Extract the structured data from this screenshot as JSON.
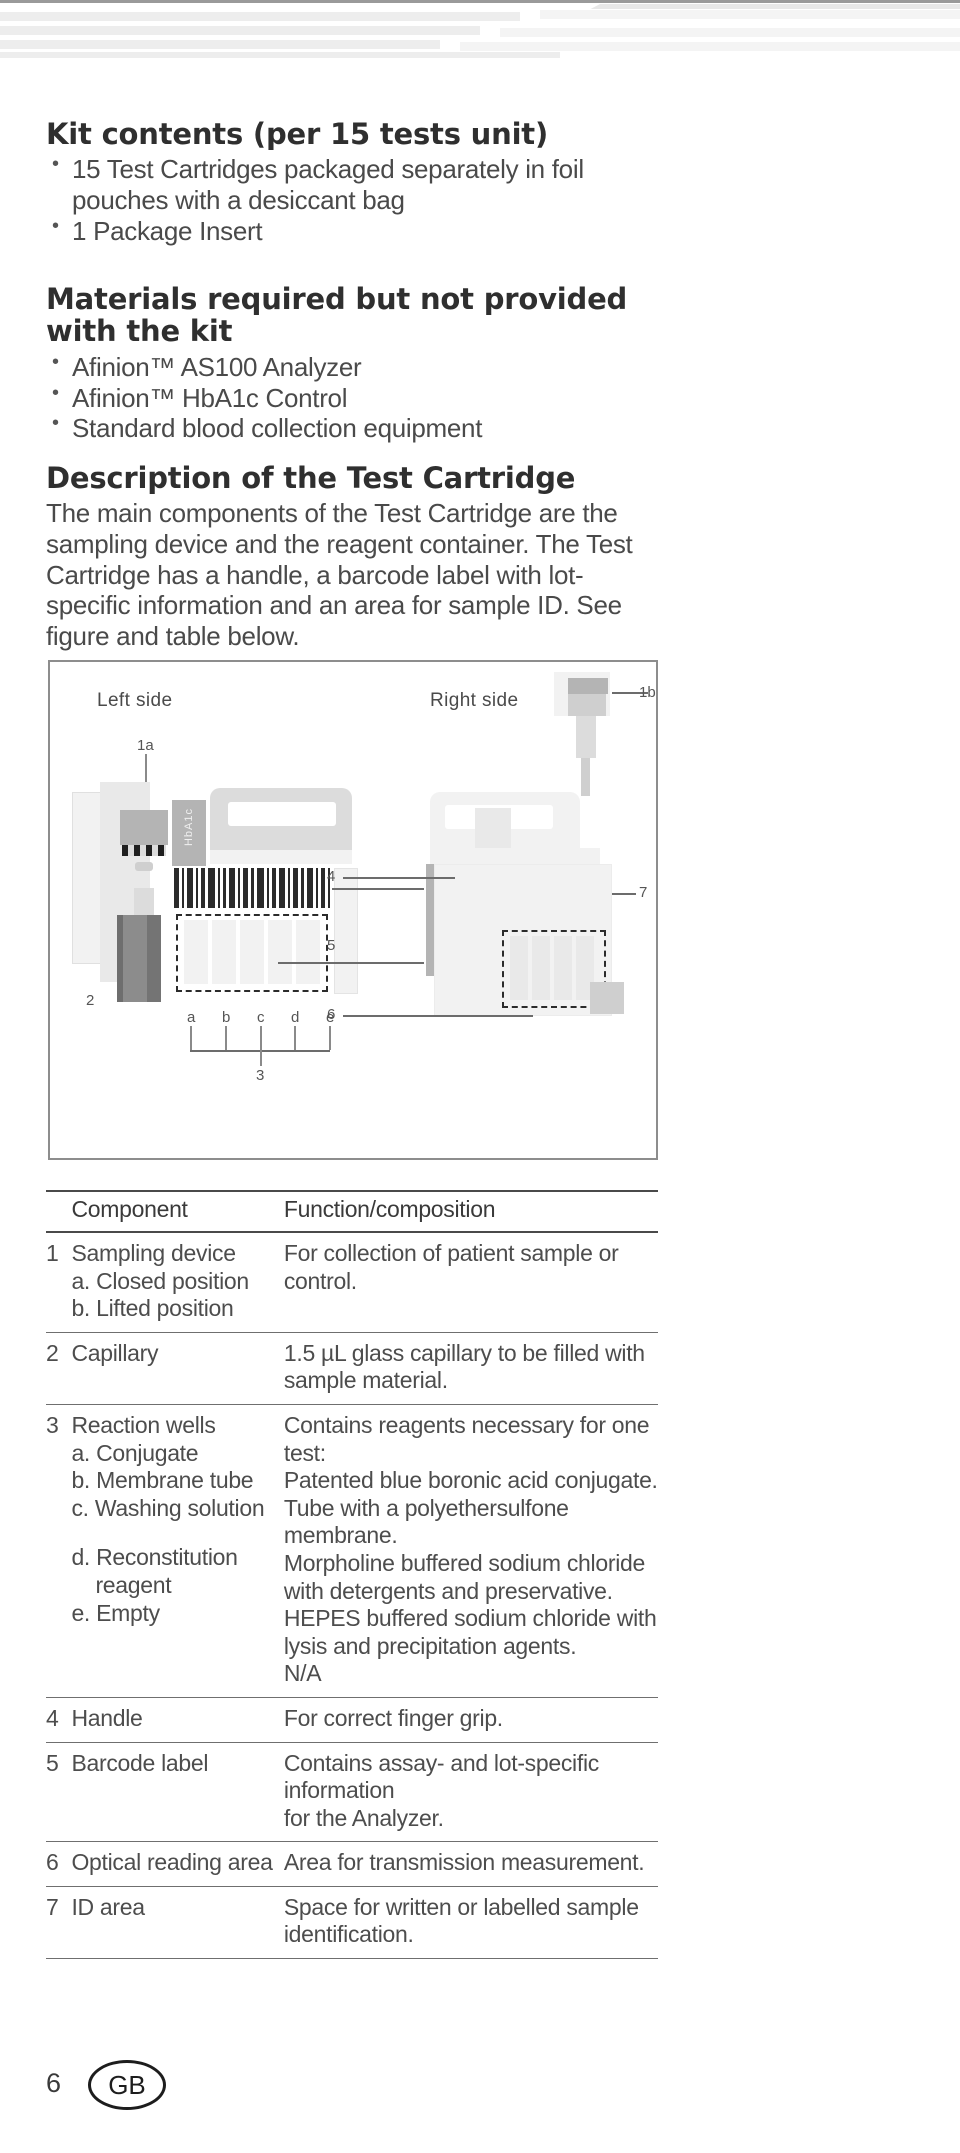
{
  "document": {
    "page_number": "6",
    "region_code": "GB"
  },
  "sections": {
    "kit_contents": {
      "heading": "Kit contents (per 15 tests unit)",
      "items": [
        "15 Test Cartridges packaged separately in foil pouches with a desiccant bag",
        "1 Package Insert"
      ]
    },
    "materials_required": {
      "heading": "Materials required but not provided with the kit",
      "items": [
        "Afinion™ AS100 Analyzer",
        "Afinion™ HbA1c Control",
        "Standard blood collection equipment"
      ]
    },
    "description": {
      "heading": "Description of the Test Cartridge",
      "paragraph": "The main components of the Test Cartridge are the sampling device and the reagent container. The Test Cartridge has a handle, a barcode label with lot-specific information and an area for sample ID. See figure and table below."
    }
  },
  "figure": {
    "left_caption": "Left side",
    "right_caption": "Right side",
    "cartridge_label": "HbA1c",
    "callouts": [
      {
        "id": "1a",
        "label": "1a"
      },
      {
        "id": "1b",
        "label": "1b"
      },
      {
        "id": "2",
        "label": "2"
      },
      {
        "id": "3",
        "label": "3"
      },
      {
        "id": "4",
        "label": "4"
      },
      {
        "id": "5",
        "label": "5"
      },
      {
        "id": "6",
        "label": "6"
      },
      {
        "id": "7",
        "label": "7"
      },
      {
        "id": "a",
        "label": "a"
      },
      {
        "id": "b",
        "label": "b"
      },
      {
        "id": "c",
        "label": "c"
      },
      {
        "id": "d",
        "label": "d"
      },
      {
        "id": "e",
        "label": "e"
      }
    ]
  },
  "table": {
    "headers": {
      "component": "Component",
      "function": "Function/composition"
    },
    "rows": [
      {
        "num": "1",
        "component_main": "Sampling device",
        "component_subs": [
          "a. Closed position",
          "b. Lifted position"
        ],
        "function_lines": [
          "For collection of patient sample or control."
        ]
      },
      {
        "num": "2",
        "component_main": "Capillary",
        "component_subs": [],
        "function_lines": [
          "1.5 µL glass capillary to be filled with",
          "sample material."
        ]
      },
      {
        "num": "3",
        "component_main": "Reaction wells",
        "component_subs": [
          "a. Conjugate",
          "b. Membrane tube",
          "c. Washing solution",
          "d. Reconstitution",
          "reagent",
          "e. Empty"
        ],
        "function_lines": [
          "Contains reagents necessary for one test:",
          "Patented blue boronic acid conjugate.",
          "Tube with a polyethersulfone membrane.",
          "Morpholine buffered sodium chloride",
          "with detergents and preservative.",
          "HEPES buffered sodium chloride with",
          "lysis and precipitation agents.",
          "N/A"
        ]
      },
      {
        "num": "4",
        "component_main": "Handle",
        "component_subs": [],
        "function_lines": [
          "For correct finger grip."
        ]
      },
      {
        "num": "5",
        "component_main": "Barcode label",
        "component_subs": [],
        "function_lines": [
          "Contains assay- and lot-specific information",
          "for the Analyzer."
        ]
      },
      {
        "num": "6",
        "component_main": "Optical reading area",
        "component_subs": [],
        "function_lines": [
          "Area for transmission measurement."
        ]
      },
      {
        "num": "7",
        "component_main": "ID area",
        "component_subs": [],
        "function_lines": [
          "Space for written or labelled sample",
          "identification."
        ]
      }
    ]
  }
}
